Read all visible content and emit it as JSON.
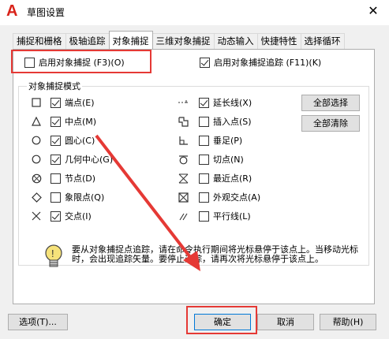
{
  "window": {
    "title": "草图设置",
    "close_glyph": "✕"
  },
  "tabs": [
    {
      "label": "捕捉和栅格",
      "active": false
    },
    {
      "label": "极轴追踪",
      "active": false
    },
    {
      "label": "对象捕捉",
      "active": true
    },
    {
      "label": "三维对象捕捉",
      "active": false
    },
    {
      "label": "动态输入",
      "active": false
    },
    {
      "label": "快捷特性",
      "active": false
    },
    {
      "label": "选择循环",
      "active": false
    }
  ],
  "top_options": {
    "osnap_on": {
      "label": "启用对象捕捉 (F3)(O)",
      "checked": false
    },
    "osnap_tracking": {
      "label": "启用对象捕捉追踪 (F11)(K)",
      "checked": true
    }
  },
  "modes_group": {
    "title": "对象捕捉模式",
    "left": [
      {
        "icon": "square-icon",
        "label": "端点(E)",
        "checked": true
      },
      {
        "icon": "triangle-icon",
        "label": "中点(M)",
        "checked": true
      },
      {
        "icon": "circle-icon",
        "label": "圆心(C)",
        "checked": true
      },
      {
        "icon": "circle-icon",
        "label": "几何中心(G)",
        "checked": true
      },
      {
        "icon": "node-icon",
        "label": "节点(D)",
        "checked": false
      },
      {
        "icon": "diamond-icon",
        "label": "象限点(Q)",
        "checked": false
      },
      {
        "icon": "cross-icon",
        "label": "交点(I)",
        "checked": true
      }
    ],
    "right": [
      {
        "icon": "extension-icon",
        "label": "延长线(X)",
        "checked": true
      },
      {
        "icon": "insert-icon",
        "label": "插入点(S)",
        "checked": false
      },
      {
        "icon": "perpendicular-icon",
        "label": "垂足(P)",
        "checked": false
      },
      {
        "icon": "tangent-icon",
        "label": "切点(N)",
        "checked": false
      },
      {
        "icon": "nearest-icon",
        "label": "最近点(R)",
        "checked": false
      },
      {
        "icon": "apparent-intersection-icon",
        "label": "外观交点(A)",
        "checked": false
      },
      {
        "icon": "parallel-icon",
        "label": "平行线(L)",
        "checked": false
      }
    ],
    "select_all": "全部选择",
    "clear_all": "全部清除"
  },
  "hint": "要从对象捕捉点追踪，请在命令执行期间将光标悬停于该点上。当移动光标时，会出现追踪矢量。要停止追踪，请再次将光标悬停于该点上。",
  "footer": {
    "options": "选项(T)...",
    "ok": "确定",
    "cancel": "取消",
    "help": "帮助(H)"
  },
  "colors": {
    "annotation_red": "#e53935",
    "app_red": "#d9231a"
  }
}
